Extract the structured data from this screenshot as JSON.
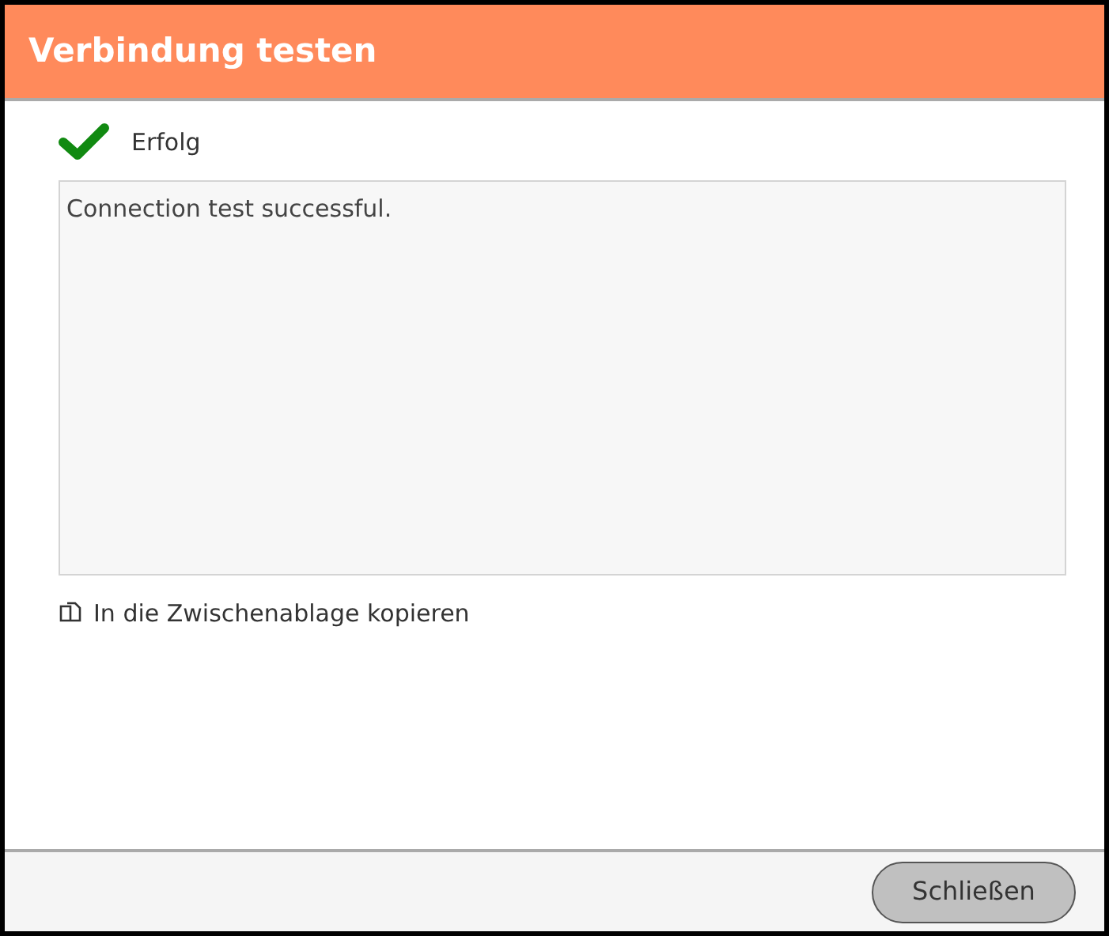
{
  "dialog": {
    "title": "Verbindung testen"
  },
  "status": {
    "kind": "success",
    "label": "Erfolg"
  },
  "output": {
    "value": "Connection test successful."
  },
  "copy_link": {
    "label": "In die Zwischenablage kopieren"
  },
  "buttons": [
    {
      "label": "Schließen"
    }
  ]
}
